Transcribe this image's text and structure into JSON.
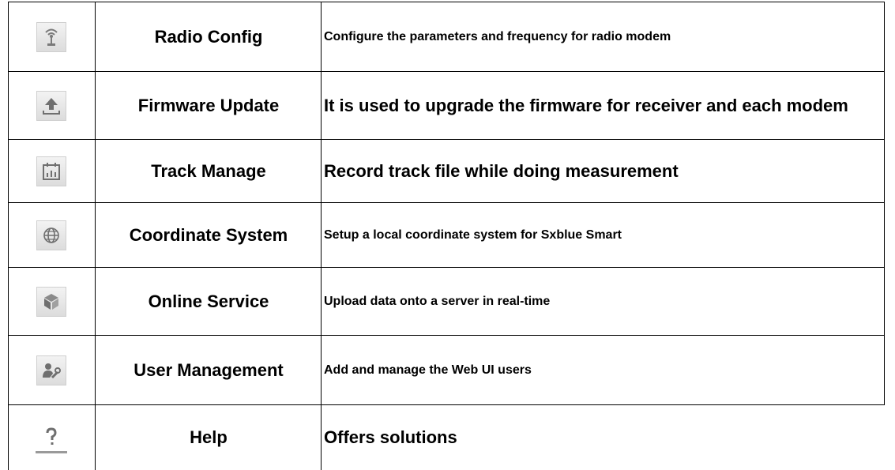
{
  "rows": [
    {
      "icon": "radio-antenna-icon",
      "name": "Radio Config",
      "description": "Configure the parameters and frequency for radio modem"
    },
    {
      "icon": "upload-arrow-icon",
      "name": "Firmware Update",
      "description": "It is used to upgrade the firmware for receiver and each modem"
    },
    {
      "icon": "calendar-chart-icon",
      "name": "Track Manage",
      "description": "Record track file while doing measurement"
    },
    {
      "icon": "globe-icon",
      "name": "Coordinate System",
      "description": "Setup a local coordinate system for Sxblue Smart"
    },
    {
      "icon": "cube-icon",
      "name": "Online Service",
      "description": "Upload data onto a server in real-time"
    },
    {
      "icon": "user-wrench-icon",
      "name": "User Management",
      "description": "Add and manage the Web UI users"
    },
    {
      "icon": "question-mark-icon",
      "name": "Help",
      "description": "Offers solutions"
    }
  ],
  "colors": {
    "text": "#000000",
    "icon_bg": "#e6e6e6",
    "icon_glyph": "#6f6f6f"
  }
}
